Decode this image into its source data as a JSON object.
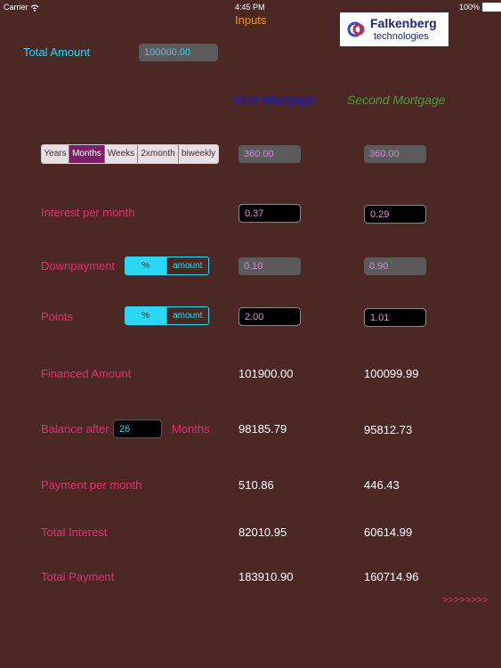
{
  "status_bar": {
    "carrier": "Carrier",
    "time": "4:45 PM",
    "battery": "100%"
  },
  "header": {
    "title": "Inputs",
    "logo_line1": "Falkenberg",
    "logo_line2": "technologies"
  },
  "total_amount": {
    "label": "Total Amount",
    "value": "100000.00"
  },
  "columns": {
    "first": "First Mortgage",
    "second": "Second Mortgage"
  },
  "period_segments": [
    "Years",
    "Months",
    "Weeks",
    "2xmonth",
    "biweekly"
  ],
  "period_selected": "Months",
  "term": {
    "first": "360.00",
    "second": "360.00"
  },
  "interest": {
    "label": "Interest per month",
    "first": "0.37",
    "second": "0.29"
  },
  "downpayment": {
    "label": "Downpayment",
    "toggle_pct": "%",
    "toggle_amount": "amount",
    "first": "0.10",
    "second": "0.90"
  },
  "points": {
    "label": "Points",
    "toggle_pct": "%",
    "toggle_amount": "amount",
    "first": "2.00",
    "second": "1.01"
  },
  "financed": {
    "label": "Financed Amount",
    "first": "101900.00",
    "second": "100099.99"
  },
  "balance": {
    "label": "Balance after",
    "months_value": "26",
    "months_label": "Months",
    "first": "98185.79",
    "second": "95812.73"
  },
  "payment": {
    "label": "Payment per month",
    "first": "510.86",
    "second": "446.43"
  },
  "total_interest": {
    "label": "Total Interest",
    "first": "82010.95",
    "second": "60614.99"
  },
  "total_payment": {
    "label": "Total Payment",
    "first": "183910.90",
    "second": "160714.96"
  },
  "next_link": ">>>>>>>>",
  "colors": {
    "background": "#4b2824",
    "pink": "#e0336a",
    "cyan": "#2ad7f5",
    "orange": "#ff8c1a",
    "blue": "#1a1ad8",
    "green": "#4f9a3a"
  }
}
